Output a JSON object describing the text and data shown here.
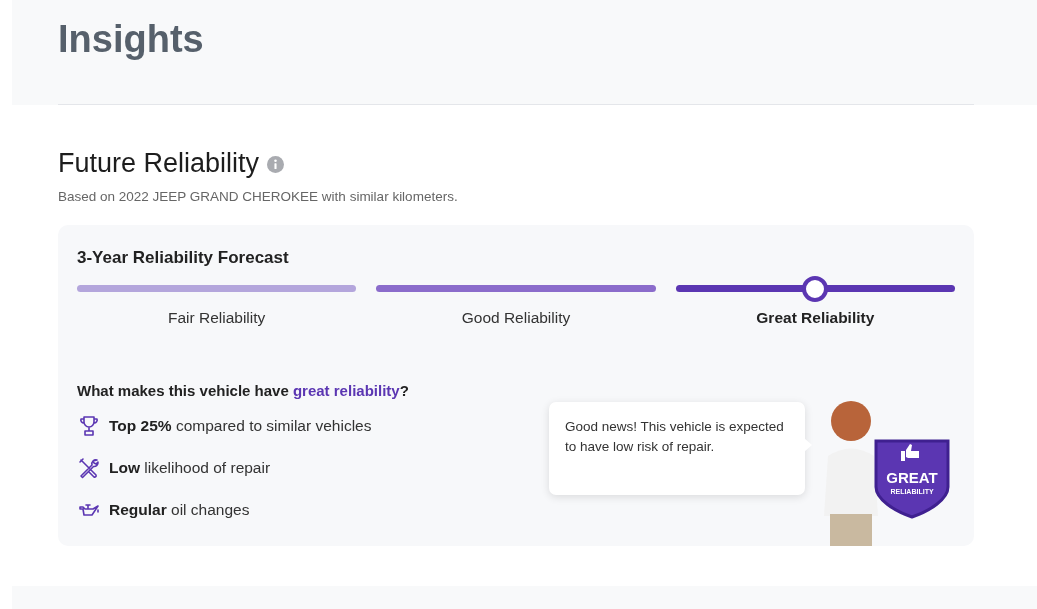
{
  "page_title": "Insights",
  "section": {
    "title": "Future Reliability",
    "subtitle": "Based on 2022 JEEP GRAND CHEROKEE with similar kilometers."
  },
  "forecast": {
    "title": "3-Year Reliability Forecast",
    "levels": [
      {
        "label": "Fair Reliability",
        "color": "#b4a6dc",
        "selected": false
      },
      {
        "label": "Good Reliability",
        "color": "#8b6ccb",
        "selected": false
      },
      {
        "label": "Great Reliability",
        "color": "#5b36b2",
        "selected": true
      }
    ],
    "question": "What makes this vehicle have **great reliability**?",
    "reasons": [
      {
        "kind": "trophy",
        "text": "**Top 25%** compared to similar vehicles"
      },
      {
        "kind": "tools",
        "text": "**Low** likelihood of repair"
      },
      {
        "kind": "oil",
        "text": "**Regular** oil changes"
      }
    ],
    "callout": "Good news! This vehicle is expected to have low risk of repair.",
    "badge": {
      "line1": "GREAT",
      "line2": "RELIABILITY"
    }
  }
}
